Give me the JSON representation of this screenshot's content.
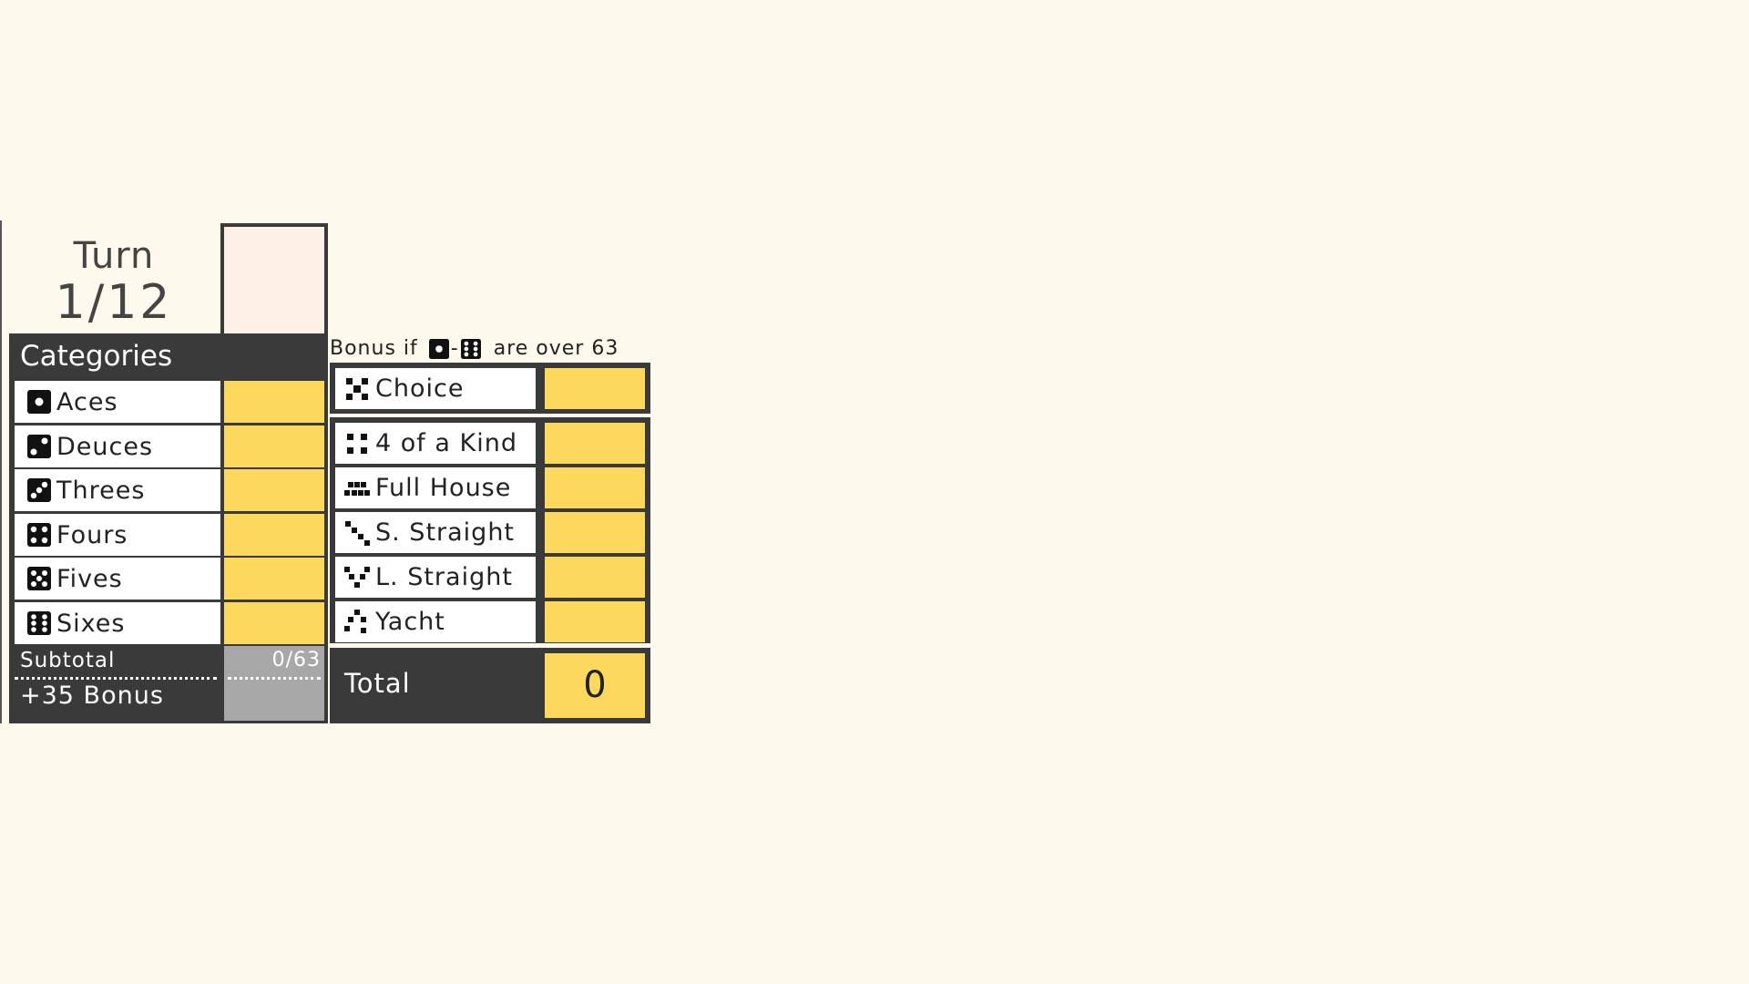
{
  "turn": {
    "label": "Turn",
    "value": "1/12"
  },
  "upper": {
    "header": "Categories",
    "rows": [
      {
        "name": "Aces",
        "icon": "die-one-icon"
      },
      {
        "name": "Deuces",
        "icon": "die-two-icon"
      },
      {
        "name": "Threes",
        "icon": "die-three-icon"
      },
      {
        "name": "Fours",
        "icon": "die-four-icon"
      },
      {
        "name": "Fives",
        "icon": "die-five-icon"
      },
      {
        "name": "Sixes",
        "icon": "die-six-icon"
      }
    ],
    "subtotal_label": "Subtotal",
    "subtotal_value": "0/63",
    "bonus_label": "+35 Bonus"
  },
  "bonus_note": {
    "prefix": "Bonus if",
    "dash": "-",
    "suffix": "are over 63"
  },
  "lower": {
    "rows": [
      {
        "name": "Choice",
        "icon": "choice-icon"
      },
      {
        "name": "4 of a Kind",
        "icon": "four-of-a-kind-icon"
      },
      {
        "name": "Full House",
        "icon": "full-house-icon"
      },
      {
        "name": "S. Straight",
        "icon": "small-straight-icon"
      },
      {
        "name": "L. Straight",
        "icon": "large-straight-icon"
      },
      {
        "name": "Yacht",
        "icon": "yacht-icon"
      }
    ]
  },
  "total": {
    "label": "Total",
    "value": "0"
  },
  "colors": {
    "background": "#fdf9ed",
    "panel": "#3a3a3a",
    "score_cell": "#fcd95c",
    "player_column": "#fdf1e7",
    "subtotal_cell": "#a8a8a8"
  }
}
